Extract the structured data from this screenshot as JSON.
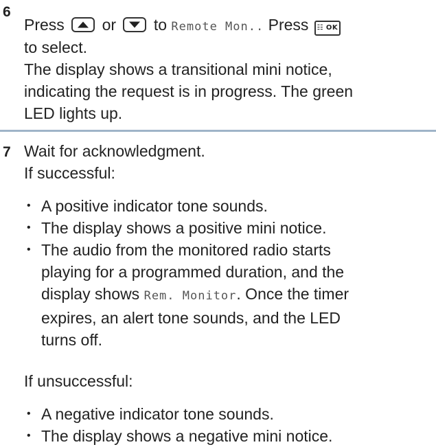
{
  "steps": [
    {
      "number": "6",
      "line1": {
        "press": "Press",
        "or": "or",
        "to": "to",
        "display_text": "Remote Mon..",
        "press2": "Press",
        "ok_key_label": "☷ OK"
      },
      "line2": "to select.",
      "para": [
        "The display shows a transitional mini notice,",
        "indicating the request is in progress. The green",
        "LED lights up."
      ]
    },
    {
      "number": "7",
      "lines": [
        "Wait for acknowledgment.",
        "If successful:"
      ],
      "success_bullets": [
        [
          "A positive indicator tone sounds."
        ],
        [
          "The display shows a positive mini notice."
        ],
        [
          "The audio from the monitored radio starts",
          "playing for a programmed duration, and the",
          {
            "before": "display shows ",
            "lcd": "Rem. Monitor",
            "after": ". Once the timer"
          },
          "expires, an alert tone sounds, and the LED",
          "turns off."
        ]
      ],
      "unsuccessful_label": "If unsuccessful:",
      "fail_bullets": [
        [
          "A negative indicator tone sounds."
        ],
        [
          "The display shows a negative mini notice."
        ]
      ]
    }
  ],
  "icons": {
    "up_key": "up-arrow-key-icon",
    "down_key": "down-arrow-key-icon",
    "ok_key": "menu-ok-key-icon"
  },
  "colors": {
    "divider": "#9fb4c8",
    "text": "#222222"
  }
}
